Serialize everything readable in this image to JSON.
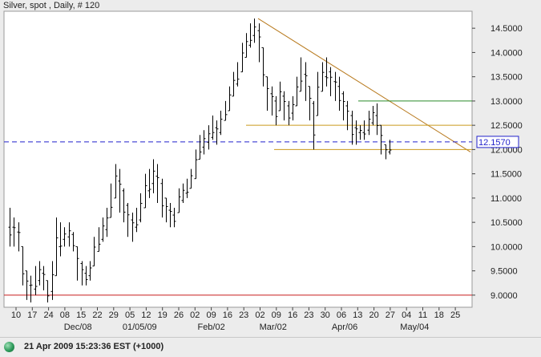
{
  "chart_data": {
    "type": "ohlc",
    "title": "Silver, spot , Daily, # 120",
    "ylim": [
      8.75,
      14.85
    ],
    "y_ticks": [
      "9.0000",
      "9.5000",
      "10.0000",
      "10.5000",
      "11.0000",
      "11.5000",
      "12.0000",
      "12.5000",
      "13.0000",
      "13.5000",
      "14.0000",
      "14.5000"
    ],
    "day_labels": [
      "10",
      "17",
      "24",
      "08",
      "15",
      "22",
      "29",
      "05",
      "12",
      "19",
      "26",
      "02",
      "09",
      "16",
      "23",
      "02",
      "09",
      "16",
      "23",
      "30",
      "06",
      "13",
      "20",
      "27",
      "04",
      "11",
      "18",
      "25"
    ],
    "month_labels": [
      "Dec/08",
      "01/05/09",
      "Feb/02",
      "Mar/02",
      "Apr/06",
      "May/04"
    ],
    "last_price": "12.1570",
    "grid": false,
    "colors": {
      "bars": "#000000",
      "trendline": "#b87a1e",
      "support": "#c99a1c",
      "resistance_green": "#2a8a2a",
      "floor_line": "#c81e1e",
      "price_line": "#2222cc"
    },
    "bars": [
      {
        "h": 10.8,
        "l": 10.0
      },
      {
        "h": 10.6,
        "l": 10.0
      },
      {
        "h": 10.5,
        "l": 9.9
      },
      {
        "h": 10.0,
        "l": 9.2
      },
      {
        "h": 9.5,
        "l": 8.9
      },
      {
        "h": 9.4,
        "l": 8.85
      },
      {
        "h": 9.6,
        "l": 9.0
      },
      {
        "h": 9.7,
        "l": 9.2
      },
      {
        "h": 9.6,
        "l": 9.1
      },
      {
        "h": 9.3,
        "l": 8.85
      },
      {
        "h": 9.7,
        "l": 8.9
      },
      {
        "h": 10.6,
        "l": 9.4
      },
      {
        "h": 10.5,
        "l": 9.8
      },
      {
        "h": 10.4,
        "l": 10.0
      },
      {
        "h": 10.5,
        "l": 10.0
      },
      {
        "h": 10.3,
        "l": 9.9
      },
      {
        "h": 10.0,
        "l": 9.3
      },
      {
        "h": 9.7,
        "l": 9.2
      },
      {
        "h": 9.6,
        "l": 9.2
      },
      {
        "h": 9.7,
        "l": 9.3
      },
      {
        "h": 10.2,
        "l": 9.6
      },
      {
        "h": 10.4,
        "l": 9.9
      },
      {
        "h": 10.6,
        "l": 10.1
      },
      {
        "h": 10.8,
        "l": 10.2
      },
      {
        "h": 11.3,
        "l": 10.6
      },
      {
        "h": 11.7,
        "l": 11.0
      },
      {
        "h": 11.6,
        "l": 10.7
      },
      {
        "h": 11.2,
        "l": 10.5
      },
      {
        "h": 10.9,
        "l": 10.2
      },
      {
        "h": 10.7,
        "l": 10.1
      },
      {
        "h": 10.8,
        "l": 10.3
      },
      {
        "h": 11.1,
        "l": 10.5
      },
      {
        "h": 11.5,
        "l": 10.8
      },
      {
        "h": 11.6,
        "l": 11.0
      },
      {
        "h": 11.8,
        "l": 11.1
      },
      {
        "h": 11.7,
        "l": 10.9
      },
      {
        "h": 11.4,
        "l": 10.6
      },
      {
        "h": 11.0,
        "l": 10.5
      },
      {
        "h": 10.9,
        "l": 10.4
      },
      {
        "h": 10.8,
        "l": 10.4
      },
      {
        "h": 11.2,
        "l": 10.7
      },
      {
        "h": 11.3,
        "l": 10.9
      },
      {
        "h": 11.4,
        "l": 11.0
      },
      {
        "h": 11.6,
        "l": 11.2
      },
      {
        "h": 12.0,
        "l": 11.4
      },
      {
        "h": 12.3,
        "l": 11.8
      },
      {
        "h": 12.4,
        "l": 11.9
      },
      {
        "h": 12.5,
        "l": 12.0
      },
      {
        "h": 12.7,
        "l": 12.2
      },
      {
        "h": 12.6,
        "l": 12.1
      },
      {
        "h": 12.8,
        "l": 12.3
      },
      {
        "h": 13.0,
        "l": 12.6
      },
      {
        "h": 13.3,
        "l": 12.8
      },
      {
        "h": 13.6,
        "l": 13.1
      },
      {
        "h": 13.8,
        "l": 13.3
      },
      {
        "h": 14.2,
        "l": 13.6
      },
      {
        "h": 14.4,
        "l": 13.9
      },
      {
        "h": 14.6,
        "l": 14.1
      },
      {
        "h": 14.7,
        "l": 14.2
      },
      {
        "h": 14.6,
        "l": 13.8
      },
      {
        "h": 14.1,
        "l": 13.3
      },
      {
        "h": 13.5,
        "l": 12.8
      },
      {
        "h": 13.3,
        "l": 12.7
      },
      {
        "h": 13.1,
        "l": 12.5
      },
      {
        "h": 13.4,
        "l": 12.8
      },
      {
        "h": 13.2,
        "l": 12.6
      },
      {
        "h": 13.0,
        "l": 12.5
      },
      {
        "h": 13.1,
        "l": 12.6
      },
      {
        "h": 13.5,
        "l": 12.9
      },
      {
        "h": 13.9,
        "l": 13.2
      },
      {
        "h": 13.8,
        "l": 13.0
      },
      {
        "h": 13.3,
        "l": 12.6
      },
      {
        "h": 13.0,
        "l": 12.0
      },
      {
        "h": 13.6,
        "l": 12.7
      },
      {
        "h": 13.8,
        "l": 13.2
      },
      {
        "h": 13.9,
        "l": 13.3
      },
      {
        "h": 13.7,
        "l": 13.1
      },
      {
        "h": 13.6,
        "l": 13.0
      },
      {
        "h": 13.5,
        "l": 12.8
      },
      {
        "h": 13.2,
        "l": 12.6
      },
      {
        "h": 13.0,
        "l": 12.4
      },
      {
        "h": 12.8,
        "l": 12.1
      },
      {
        "h": 12.6,
        "l": 12.1
      },
      {
        "h": 12.5,
        "l": 12.2
      },
      {
        "h": 12.6,
        "l": 12.2
      },
      {
        "h": 12.8,
        "l": 12.3
      },
      {
        "h": 12.9,
        "l": 12.5
      },
      {
        "h": 12.95,
        "l": 12.3
      },
      {
        "h": 12.5,
        "l": 11.9
      },
      {
        "h": 12.1,
        "l": 11.8
      },
      {
        "h": 12.2,
        "l": 11.9
      }
    ]
  },
  "status": {
    "datetime_text": "21 Apr 2009 15:23:36  EST (+1000)"
  }
}
